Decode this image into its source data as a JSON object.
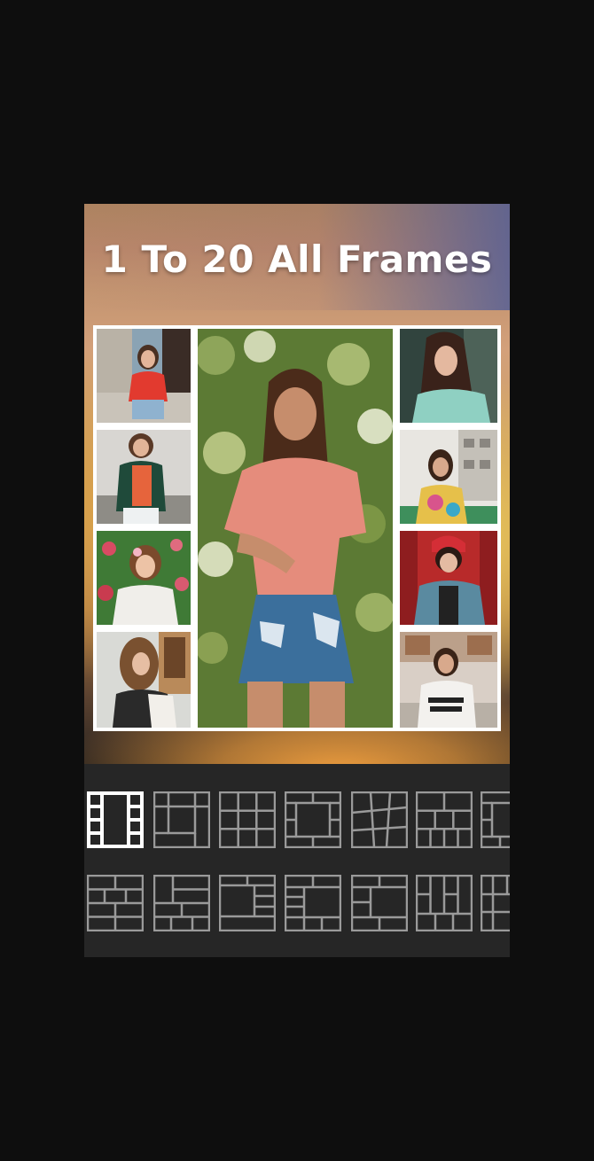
{
  "promo": {
    "title": "1 To 20 All Frames"
  },
  "collage": {
    "photos": [
      {
        "name": "photo-woman-red-shirt-street",
        "description_icon": "photo-icon"
      },
      {
        "name": "photo-woman-green-jacket",
        "description_icon": "photo-icon"
      },
      {
        "name": "photo-woman-flowers-lace",
        "description_icon": "photo-icon"
      },
      {
        "name": "photo-woman-long-hair-room",
        "description_icon": "photo-icon"
      },
      {
        "name": "photo-woman-pink-shirt-center",
        "description_icon": "photo-icon"
      },
      {
        "name": "photo-woman-white-knit",
        "description_icon": "photo-icon"
      },
      {
        "name": "photo-woman-tie-dye",
        "description_icon": "photo-icon"
      },
      {
        "name": "photo-woman-red-beanie",
        "description_icon": "photo-icon"
      },
      {
        "name": "photo-woman-dream-chasers",
        "description_icon": "photo-icon"
      }
    ]
  },
  "frames": {
    "selected_index": 0,
    "row1": [
      "frame-layout-1",
      "frame-layout-2",
      "frame-layout-3",
      "frame-layout-4",
      "frame-layout-5",
      "frame-layout-6",
      "frame-layout-7"
    ],
    "row2": [
      "frame-layout-8",
      "frame-layout-9",
      "frame-layout-10",
      "frame-layout-11",
      "frame-layout-12",
      "frame-layout-13",
      "frame-layout-14"
    ]
  },
  "colors": {
    "background": "#0e0e0e",
    "panel": "#262626",
    "frame_icon_default": "#9a9a9a",
    "frame_icon_selected": "#ffffff",
    "title": "#ffffff"
  }
}
